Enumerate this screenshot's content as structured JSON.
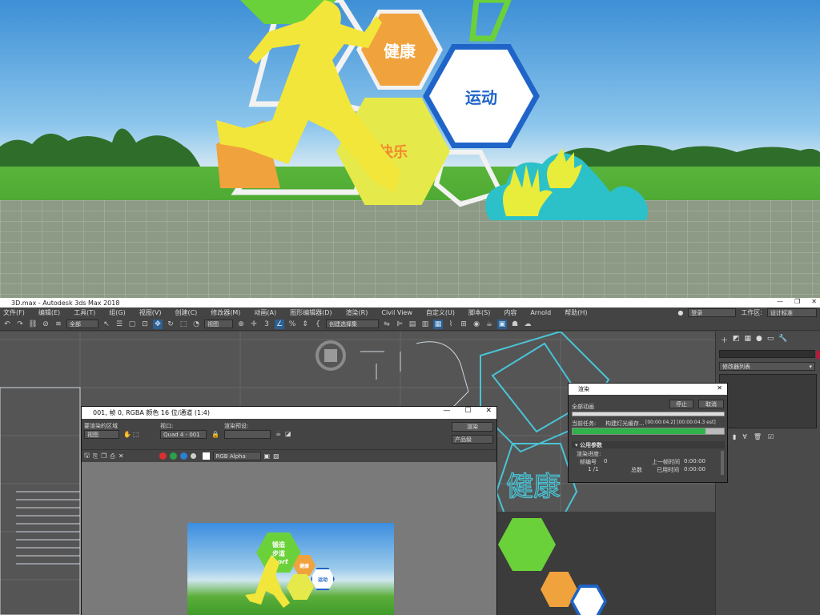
{
  "scene": {
    "hex_labels": [
      "健康",
      "运动",
      "快乐"
    ],
    "colors": {
      "sky": "#5aa6e4",
      "grass": "#4fae32",
      "yellow": "#f2e63a",
      "orange": "#f0a23c",
      "blue": "#1f64c8",
      "green": "#6bd13a",
      "cyan": "#2cc0c8"
    }
  },
  "app": {
    "title": "3D.max - Autodesk 3ds Max 2018",
    "menu": [
      "文件(F)",
      "编辑(E)",
      "工具(T)",
      "组(G)",
      "视图(V)",
      "创建(C)",
      "修改器(M)",
      "动画(A)",
      "图形编辑器(D)",
      "渲染(R)",
      "Civil View",
      "自定义(U)",
      "脚本(S)",
      "内容",
      "Arnold",
      "帮助(H)"
    ],
    "login": "登录",
    "workspace_label": "工作区:",
    "workspace_value": "设计标准",
    "toolbar": {
      "filter": "全部",
      "view": "视图",
      "selection_set": "创建选择集"
    },
    "command_panel": {
      "modifier_list": "修改器列表"
    },
    "viewport_text": "健康"
  },
  "vfb": {
    "title": "001, 帧 0, RGBA 颜色 16 位/通道 (1:4)",
    "area_label": "要渲染的区域",
    "area_value": "视图",
    "viewport_label": "视口:",
    "viewport_value": "Quad 4 - 001",
    "preset_label": "渲染预设:",
    "render_button": "渲染",
    "product_value": "产品级",
    "channel_value": "RGB Alpha",
    "thumb_labels": [
      "锻造",
      "步道",
      "sport",
      "健康",
      "运动"
    ]
  },
  "render_dialog": {
    "title": "渲染",
    "all_animation": "全部动画",
    "stop": "停止",
    "cancel": "取消",
    "current_task_label": "当前任务:",
    "current_task": "构建灯光缓存...",
    "time": "[00:00:04.2] [00:00:04.3 est]",
    "progress": 0.88,
    "section": "公用参数",
    "render_progress": "渲染进度:",
    "frame_label": "帧编号",
    "frame_value": "0",
    "prev_frame_label": "上一帧时间",
    "prev_frame_value": "0:00:00",
    "frames": "1 /1",
    "total_label": "总数",
    "elapsed_label": "已用时间",
    "elapsed_value": "0:00:00"
  }
}
